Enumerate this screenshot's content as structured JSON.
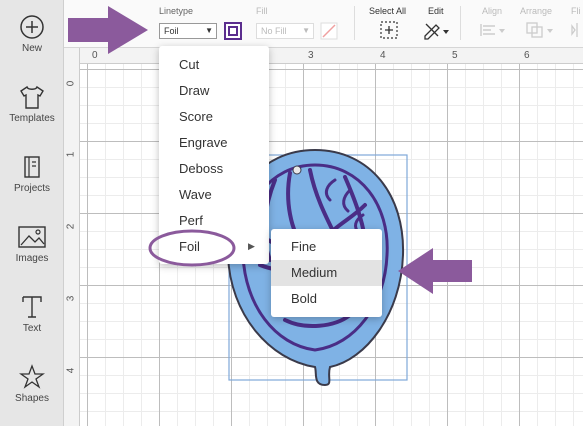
{
  "sidebar": {
    "items": [
      {
        "label": "New",
        "icon": "plus-circle-icon"
      },
      {
        "label": "Templates",
        "icon": "shirt-icon"
      },
      {
        "label": "Projects",
        "icon": "projects-icon"
      },
      {
        "label": "Images",
        "icon": "image-icon"
      },
      {
        "label": "Text",
        "icon": "text-t-icon"
      },
      {
        "label": "Shapes",
        "icon": "shapes-icon"
      }
    ]
  },
  "toolbar": {
    "linetype_label": "Linetype",
    "linetype_value": "Foil",
    "fill_label": "Fill",
    "fill_value": "No Fill",
    "select_all_label": "Select All",
    "edit_label": "Edit",
    "align_label": "Align",
    "arrange_label": "Arrange",
    "flip_label": "Fli"
  },
  "ruler": {
    "top": [
      "0",
      "3",
      "4",
      "5",
      "6"
    ],
    "left": [
      "0",
      "1",
      "2",
      "3",
      "4"
    ]
  },
  "linetype_menu": {
    "items": [
      "Cut",
      "Draw",
      "Score",
      "Engrave",
      "Deboss",
      "Wave",
      "Perf",
      "Foil"
    ]
  },
  "foil_submenu": {
    "items": [
      "Fine",
      "Medium",
      "Bold"
    ],
    "highlighted": "Medium"
  },
  "colors": {
    "accent_purple": "#8b5a9c",
    "linetype_swatch": "#5b2d8e",
    "design_fill": "#7fb2e5",
    "design_line": "#4a2d86"
  }
}
